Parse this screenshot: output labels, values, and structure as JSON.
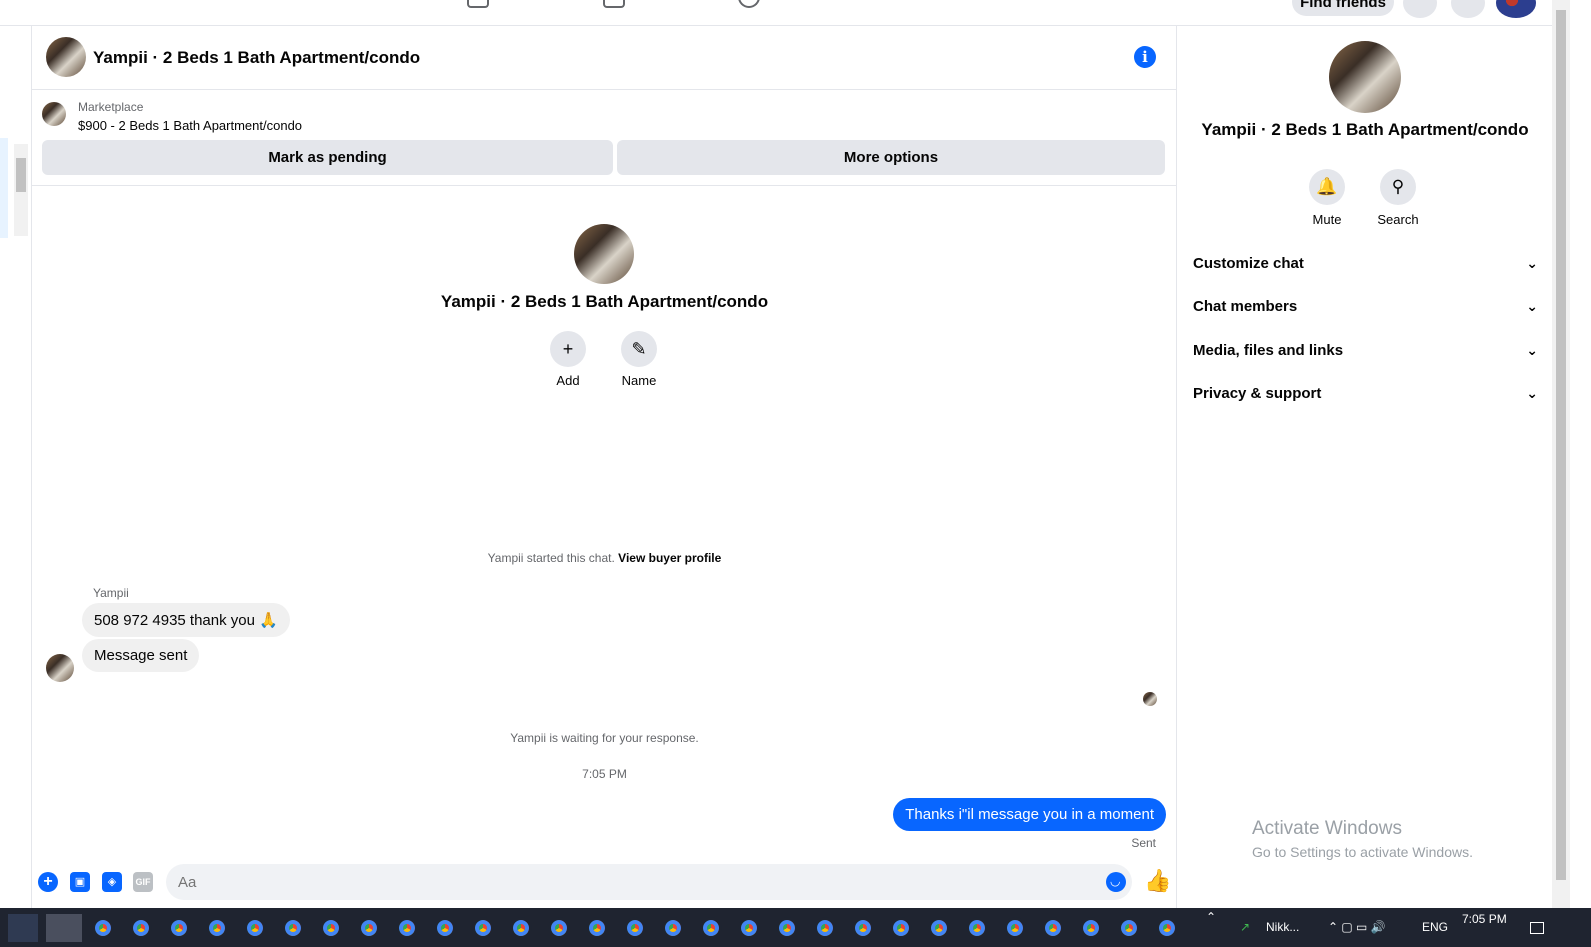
{
  "topbar": {
    "find_friends": "Find friends"
  },
  "chat": {
    "title": "Yampii · 2 Beds 1 Bath Apartment/condo",
    "marketplace_label": "Marketplace",
    "listing": "$900 - 2 Beds 1 Bath Apartment/condo",
    "mark_pending": "Mark as pending",
    "more_options": "More options",
    "center_name": "Yampii · 2 Beds 1 Bath Apartment/condo",
    "add_label": "Add",
    "name_label": "Name",
    "started_text": "Yampii started this chat.",
    "view_buyer": "View buyer profile",
    "sender": "Yampii",
    "msg1": "508 972 4935 thank you 🙏",
    "msg2": "Message sent",
    "waiting": "Yampii is waiting for your response.",
    "time": "7:05 PM",
    "outgoing": "Thanks i\"il message you in a moment",
    "sent_status": "Sent",
    "composer_placeholder": "Aa"
  },
  "panel": {
    "name": "Yampii · 2 Beds 1 Bath Apartment/condo",
    "mute": "Mute",
    "search": "Search",
    "sections": [
      "Customize chat",
      "Chat members",
      "Media, files and links",
      "Privacy & support"
    ]
  },
  "watermark": {
    "line1": "Activate Windows",
    "line2": "Go to Settings to activate Windows."
  },
  "taskbar": {
    "app_label": "Nikk...",
    "lang": "ENG",
    "clock": "7:05 PM"
  },
  "colors": {
    "accent": "#0866ff",
    "bubble_in": "#f0f0f0",
    "border": "#e4e6eb"
  }
}
